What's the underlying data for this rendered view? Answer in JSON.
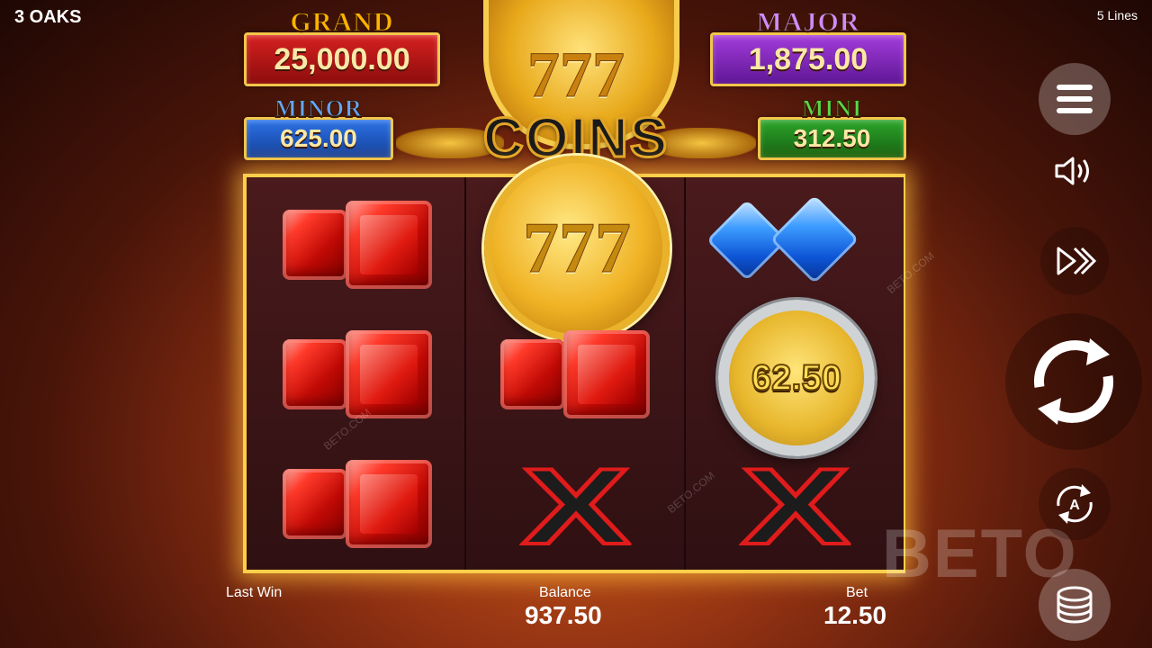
{
  "game": {
    "brand": "3 OAKS",
    "lines": "5 Lines"
  },
  "jackpots": {
    "grand": {
      "label": "GRAND",
      "value": "25,000.00",
      "color": "#d62020"
    },
    "major": {
      "label": "MAJOR",
      "value": "1,875.00",
      "color": "#a33cdb"
    },
    "minor": {
      "label": "MINOR",
      "value": "625.00",
      "color": "#2d73e6"
    },
    "mini": {
      "label": "MINI",
      "value": "312.50",
      "color": "#2ea62a"
    }
  },
  "logo": {
    "numerals": "777",
    "word": "COINS"
  },
  "reels": {
    "reel1": [
      "ruby",
      "ruby",
      "ruby"
    ],
    "reel2": [
      "777-coin",
      "ruby",
      "x"
    ],
    "reel3": [
      "diamond",
      "silver-coin",
      "x"
    ],
    "coin_numerals": "777",
    "silver_coin_value": "62.50"
  },
  "footer": {
    "last_win_label": "Last Win",
    "balance_label": "Balance",
    "balance_value": "937.50",
    "bet_label": "Bet",
    "bet_value": "12.50"
  },
  "controls": {
    "menu": "menu-icon",
    "sound": "speaker-icon",
    "turbo": "fast-forward-icon",
    "spin": "spin-icon",
    "autoplay": "autoplay-icon",
    "autoplay_letter": "A",
    "bet": "coin-stack-icon"
  },
  "watermark": {
    "text": "BETO",
    "small": "BETO.COM"
  }
}
